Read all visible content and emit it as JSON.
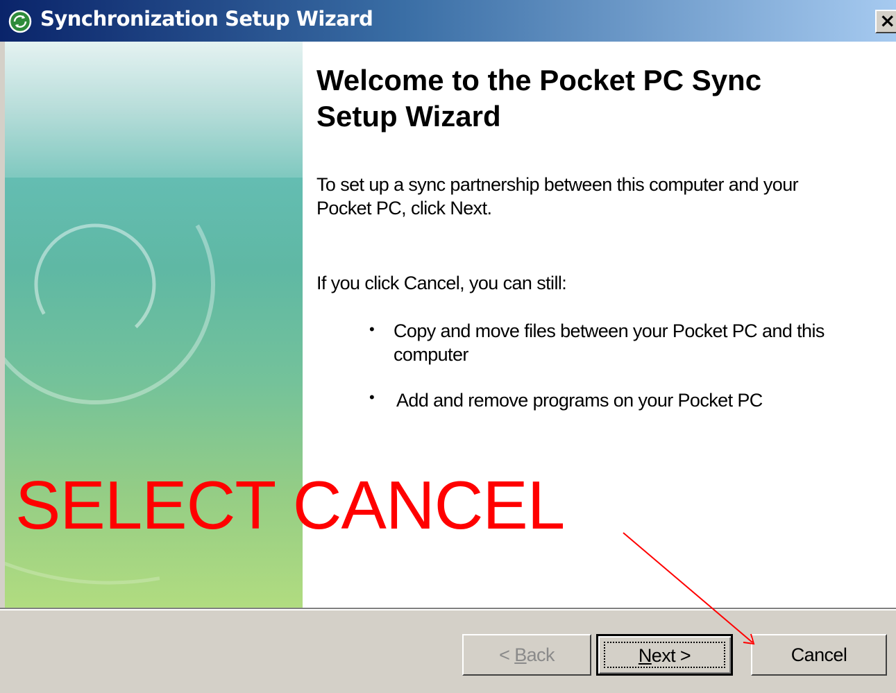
{
  "window": {
    "title": "Synchronization Setup Wizard",
    "close_label": "×"
  },
  "main": {
    "heading": "Welcome to the Pocket PC Sync Setup Wizard",
    "paragraph_1": "To set up a sync partnership between this computer and your Pocket PC, click Next.",
    "paragraph_2": "If you click Cancel, you can still:",
    "bullets": [
      "Copy and move files between your Pocket PC and this computer",
      "Add and remove programs on your Pocket PC"
    ]
  },
  "buttons": {
    "back": {
      "prefix": "< ",
      "mnemonic": "B",
      "rest": "ack",
      "enabled": false
    },
    "next": {
      "mnemonic": "N",
      "rest": "ext >",
      "enabled": true,
      "default": true
    },
    "cancel": {
      "label": "Cancel",
      "enabled": true
    }
  },
  "annotation": {
    "text": "SELECT CANCEL",
    "color": "#ff0000"
  },
  "colors": {
    "titlebar_start": "#0a246a",
    "titlebar_end": "#a6caf0",
    "dialog_face": "#d4d0c8"
  },
  "icons": {
    "title_icon": "sync-arrows-icon",
    "close": "close-icon"
  }
}
